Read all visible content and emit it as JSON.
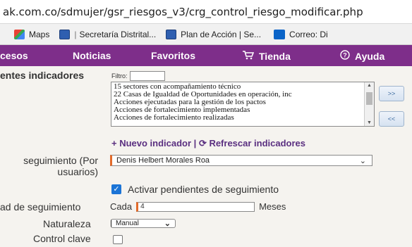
{
  "browser": {
    "url": "ak.com.co/sdmujer/gsr_riesgos_v3/crg_control_riesgo_modificar.php"
  },
  "bookmarks": [
    {
      "label": "Maps",
      "icon": "maps-icon"
    },
    {
      "label": "Secretaría Distrital...",
      "icon": "bookmark-icon"
    },
    {
      "label": "Plan de Acción | Se...",
      "icon": "bookmark-icon"
    },
    {
      "label": "Correo: Di",
      "icon": "outlook-icon"
    }
  ],
  "bookmark_separator": "|",
  "nav": {
    "items": [
      {
        "label": "cesos"
      },
      {
        "label": "Noticias"
      },
      {
        "label": "Favoritos"
      },
      {
        "label": "Tienda",
        "icon": "cart-icon"
      },
      {
        "label": "Ayuda",
        "icon": "help-icon"
      }
    ],
    "background": "#7e2e8a"
  },
  "form": {
    "indicadores_label": "entes indicadores",
    "filtro_label": "Filtro:",
    "filtro_value": "",
    "indicator_options": [
      "15 sectores con acompañamiento técnico",
      "22 Casas de Igualdad de Oportunidades en operación, inc",
      "Acciones ejecutadas para la gestión de los pactos",
      "Acciones de fortalecimiento implementadas",
      "Acciones de fortalecimiento realizadas"
    ],
    "move_right_label": ">>",
    "move_left_label": "<<",
    "nuevo_indicador": "+ Nuevo indicador",
    "links_separator": " | ",
    "refrescar": "⟳ Refrescar indicadores",
    "seguimiento_label_line1": "seguimiento (Por",
    "seguimiento_label_line2": "usuarios)",
    "seguimiento_value": "Denis Helbert Morales Roa",
    "activar_label": "Activar pendientes de seguimiento",
    "activar_checked": true,
    "frecuencia_label": "ad de seguimiento",
    "cada_label": "Cada",
    "cada_value": "4",
    "unit_label": "Meses",
    "naturaleza_label": "Naturaleza",
    "naturaleza_value": "Manual",
    "control_clave_label": "Control clave",
    "control_clave_checked": false
  },
  "colors": {
    "accent_purple": "#7e2e8a",
    "link_purple": "#5a2f80",
    "required_orange": "#e36b2a",
    "checkbox_blue": "#1b74d6"
  }
}
